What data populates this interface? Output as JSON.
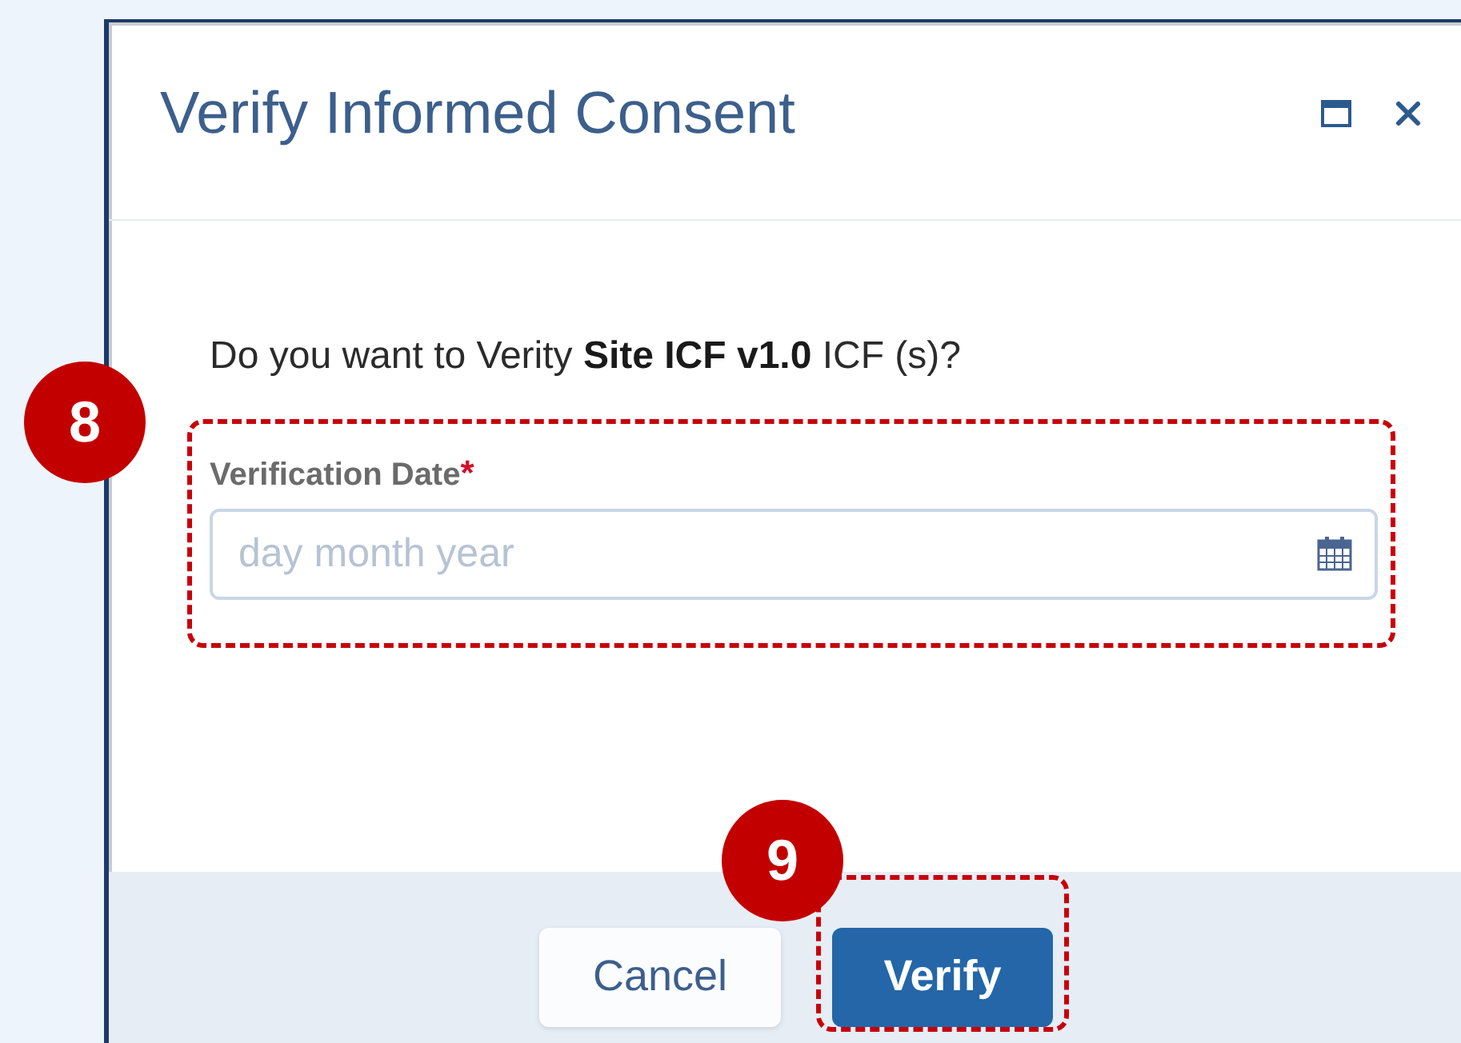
{
  "dialog": {
    "title": "Verify Informed Consent",
    "question": "Do you want to Verity **Site ICF v1.0** ICF (s)?",
    "field": {
      "label": "Verification Date",
      "required": true,
      "required_mark": "*",
      "placeholder": "day month year"
    },
    "buttons": [
      {
        "label": "Cancel",
        "kind": "secondary"
      },
      {
        "label": "Verify",
        "kind": "primary"
      }
    ]
  },
  "callouts": [
    {
      "number": "8"
    },
    {
      "number": "9"
    }
  ]
}
